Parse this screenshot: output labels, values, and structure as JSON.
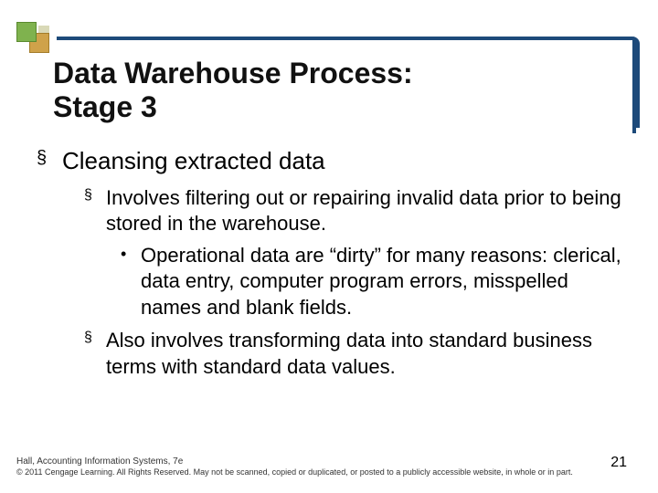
{
  "title_line1": "Data Warehouse Process:",
  "title_line2": "Stage 3",
  "bullets": {
    "main": "Cleansing extracted data",
    "sub1": "Involves filtering out or repairing invalid data prior to being stored in the warehouse.",
    "sub1a": "Operational data are “dirty” for many reasons: clerical, data entry, computer program errors, misspelled names and blank fields.",
    "sub2": "Also involves transforming data into standard business terms with standard data values."
  },
  "footer": {
    "line1": "Hall, Accounting Information Systems, 7e",
    "line2": "© 2011 Cengage Learning. All Rights Reserved. May not be scanned, copied or duplicated, or posted to a publicly accessible website, in whole or in part."
  },
  "page_number": "21",
  "glyphs": {
    "square": "§",
    "disc": "•"
  }
}
